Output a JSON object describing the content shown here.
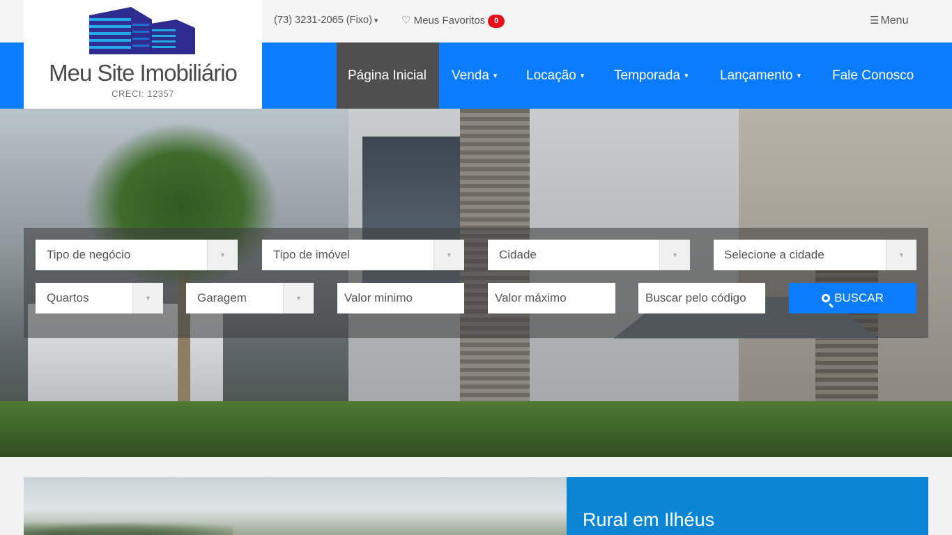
{
  "topbar": {
    "phone": "(73) 3231-2065 (Fixo)",
    "phone_caret": "▾",
    "favorites_label": "Meus Favoritos",
    "favorites_icon": "heart-outline-icon",
    "favorites_count": "0",
    "menu_icon": "hamburger-icon",
    "menu_label": "Menu"
  },
  "logo": {
    "name": "Meu Site Imobiliário",
    "creci": "CRECI: 12357",
    "colors": {
      "dark": "#2f2c8f",
      "mid": "#1f6fd1",
      "light": "#23a8e8"
    }
  },
  "nav": {
    "items": [
      {
        "label": "Página Inicial",
        "active": true,
        "dropdown": false
      },
      {
        "label": "Venda",
        "active": false,
        "dropdown": true
      },
      {
        "label": "Locação",
        "active": false,
        "dropdown": true
      },
      {
        "label": "Temporada",
        "active": false,
        "dropdown": true
      },
      {
        "label": "Lançamento",
        "active": false,
        "dropdown": true
      },
      {
        "label": "Fale Conosco",
        "active": false,
        "dropdown": false
      }
    ],
    "caret": "▾"
  },
  "search": {
    "tipo_negocio": "Tipo de negócio",
    "tipo_imovel": "Tipo de imóvel",
    "cidade": "Cidade",
    "selecione_cidade": "Selecione a cidade",
    "quartos": "Quartos",
    "garagem": "Garagem",
    "valor_minimo": "Valor minimo",
    "valor_maximo": "Valor máximo",
    "codigo": "Buscar pelo código",
    "button_label": "BUSCAR",
    "arrow": "▼"
  },
  "featured": {
    "title": "Rural em Ilhéus"
  },
  "colors": {
    "primary": "#0a7cfd",
    "nav_active": "#4f4f4f",
    "badge": "#e8101b",
    "card": "#0a85d4"
  }
}
